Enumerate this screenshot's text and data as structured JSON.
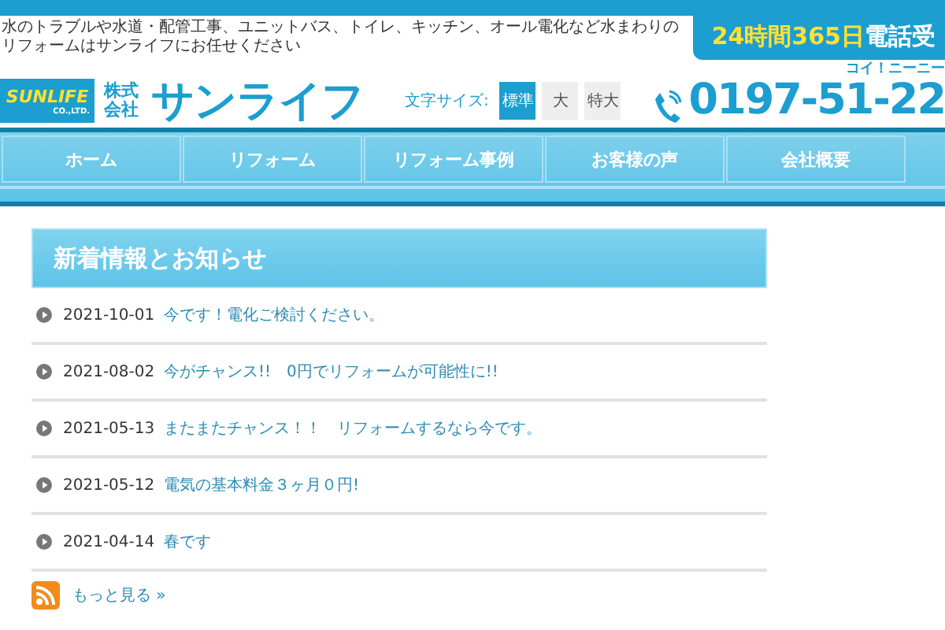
{
  "tagline": "水のトラブルや水道・配管工事、ユニットバス、トイレ、キッチン、オール電化など水まわりのリフォームはサンライフにお任せください",
  "hours_badge": {
    "hours": "24時間365日",
    "text": "電話受"
  },
  "logo": {
    "brand": "SUNLIFE",
    "sub": "CO.,LTD.",
    "company_type": "株式会社",
    "name": "サンライフ"
  },
  "font_size": {
    "label": "文字サイズ:",
    "options": [
      {
        "label": "標準",
        "selected": true
      },
      {
        "label": "大",
        "selected": false
      },
      {
        "label": "特大",
        "selected": false
      }
    ]
  },
  "phone": {
    "reading": "コイ！ニーニー",
    "number": "0197-51-22"
  },
  "nav": [
    "ホーム",
    "リフォーム",
    "リフォーム事例",
    "お客様の声",
    "会社概要"
  ],
  "news": {
    "title": "新着情報とお知らせ",
    "items": [
      {
        "date": "2021-10-01",
        "text": "今です！電化ご検討ください。"
      },
      {
        "date": "2021-08-02",
        "text": "今がチャンス!!　0円でリフォームが可能性に!!"
      },
      {
        "date": "2021-05-13",
        "text": "またまたチャンス！！　リフォームするなら今です。"
      },
      {
        "date": "2021-05-12",
        "text": "電気の基本料金３ヶ月０円!"
      },
      {
        "date": "2021-04-14",
        "text": "春です"
      }
    ],
    "more": "もっと見る »"
  }
}
